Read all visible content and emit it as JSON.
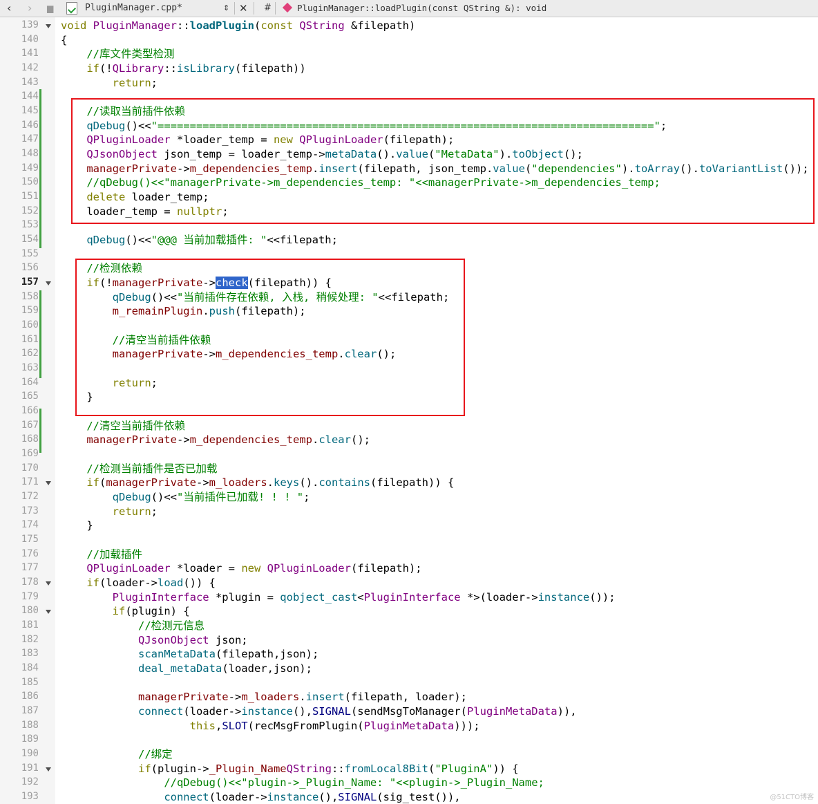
{
  "toolbar": {
    "file_name": "PluginManager.cpp*",
    "hash": "#",
    "symbol": "PluginManager::loadPlugin(const QString &): void"
  },
  "editor": {
    "line_numbers": [
      "139",
      "140",
      "141",
      "142",
      "143",
      "144",
      "145",
      "146",
      "147",
      "148",
      "149",
      "150",
      "151",
      "152",
      "153",
      "154",
      "155",
      "156",
      "157",
      "158",
      "159",
      "160",
      "161",
      "162",
      "163",
      "164",
      "165",
      "166",
      "167",
      "168",
      "169",
      "170",
      "171",
      "172",
      "173",
      "174",
      "175",
      "176",
      "177",
      "178",
      "179",
      "180",
      "181",
      "182",
      "183",
      "184",
      "185",
      "186",
      "187",
      "188",
      "189",
      "190",
      "191",
      "192",
      "193"
    ],
    "current_line": "157",
    "selected_word": "check",
    "lines": [
      [
        [
          "k",
          "void "
        ],
        [
          "t",
          "PluginManager"
        ],
        [
          "",
          "::"
        ],
        [
          "fb",
          "loadPlugin"
        ],
        [
          "",
          "("
        ],
        [
          "k",
          "const "
        ],
        [
          "t",
          "QString "
        ],
        [
          "",
          "&filepath)"
        ]
      ],
      [
        [
          "",
          "{"
        ]
      ],
      [
        [
          "",
          "    "
        ],
        [
          "c",
          "//库文件类型检测"
        ]
      ],
      [
        [
          "",
          "    "
        ],
        [
          "k",
          "if"
        ],
        [
          "",
          "(!"
        ],
        [
          "t",
          "QLibrary"
        ],
        [
          "",
          "::"
        ],
        [
          "f",
          "isLibrary"
        ],
        [
          "",
          "(filepath))"
        ]
      ],
      [
        [
          "",
          "        "
        ],
        [
          "k",
          "return"
        ],
        [
          "",
          ";"
        ]
      ],
      [],
      [
        [
          "",
          "    "
        ],
        [
          "c",
          "//读取当前插件依赖"
        ]
      ],
      [
        [
          "",
          "    "
        ],
        [
          "f",
          "qDebug"
        ],
        [
          "",
          "()<<"
        ],
        [
          "s",
          "\"=============================================================================\""
        ],
        [
          "",
          ";"
        ]
      ],
      [
        [
          "",
          "    "
        ],
        [
          "t",
          "QPluginLoader "
        ],
        [
          "",
          "*loader_temp = "
        ],
        [
          "k",
          "new "
        ],
        [
          "t",
          "QPluginLoader"
        ],
        [
          "",
          "(filepath);"
        ]
      ],
      [
        [
          "",
          "    "
        ],
        [
          "t",
          "QJsonObject "
        ],
        [
          "",
          "json_temp = loader_temp->"
        ],
        [
          "f",
          "metaData"
        ],
        [
          "",
          "()."
        ],
        [
          "f",
          "value"
        ],
        [
          "",
          "("
        ],
        [
          "s",
          "\"MetaData\""
        ],
        [
          "",
          ")."
        ],
        [
          "f",
          "toObject"
        ],
        [
          "",
          "();"
        ]
      ],
      [
        [
          "",
          "    "
        ],
        [
          "m",
          "managerPrivate"
        ],
        [
          "",
          "->"
        ],
        [
          "m",
          "m_dependencies_temp"
        ],
        [
          "",
          "."
        ],
        [
          "f",
          "insert"
        ],
        [
          "",
          "(filepath, json_temp."
        ],
        [
          "f",
          "value"
        ],
        [
          "",
          "("
        ],
        [
          "s",
          "\"dependencies\""
        ],
        [
          "",
          ")."
        ],
        [
          "f",
          "toArray"
        ],
        [
          "",
          "()."
        ],
        [
          "f",
          "toVariantList"
        ],
        [
          "",
          "());"
        ]
      ],
      [
        [
          "",
          "    "
        ],
        [
          "c",
          "//qDebug()<<\"managerPrivate->m_dependencies_temp: \"<<managerPrivate->m_dependencies_temp;"
        ]
      ],
      [
        [
          "",
          "    "
        ],
        [
          "k",
          "delete "
        ],
        [
          "",
          "loader_temp;"
        ]
      ],
      [
        [
          "",
          "    "
        ],
        [
          "",
          "loader_temp = "
        ],
        [
          "k",
          "nullptr"
        ],
        [
          "",
          ";"
        ]
      ],
      [],
      [
        [
          "",
          "    "
        ],
        [
          "f",
          "qDebug"
        ],
        [
          "",
          "()<<"
        ],
        [
          "s",
          "\"@@@ 当前加载插件: \""
        ],
        [
          "",
          "<<filepath;"
        ]
      ],
      [],
      [
        [
          "",
          "    "
        ],
        [
          "c",
          "//检测依赖"
        ]
      ],
      [
        [
          "",
          "    "
        ],
        [
          "k",
          "if"
        ],
        [
          "",
          "(!"
        ],
        [
          "m",
          "managerPrivate"
        ],
        [
          "",
          "->"
        ],
        [
          "hl",
          "check"
        ],
        [
          "",
          "(filepath)) {"
        ]
      ],
      [
        [
          "",
          "        "
        ],
        [
          "f",
          "qDebug"
        ],
        [
          "",
          "()<<"
        ],
        [
          "s",
          "\"当前插件存在依赖, 入栈, 稍候处理: \""
        ],
        [
          "",
          "<<filepath;"
        ]
      ],
      [
        [
          "",
          "        "
        ],
        [
          "m",
          "m_remainPlugin"
        ],
        [
          "",
          "."
        ],
        [
          "f",
          "push"
        ],
        [
          "",
          "(filepath);"
        ]
      ],
      [],
      [
        [
          "",
          "        "
        ],
        [
          "c",
          "//清空当前插件依赖"
        ]
      ],
      [
        [
          "",
          "        "
        ],
        [
          "m",
          "managerPrivate"
        ],
        [
          "",
          "->"
        ],
        [
          "m",
          "m_dependencies_temp"
        ],
        [
          "",
          "."
        ],
        [
          "f",
          "clear"
        ],
        [
          "",
          "();"
        ]
      ],
      [],
      [
        [
          "",
          "        "
        ],
        [
          "k",
          "return"
        ],
        [
          "",
          ";"
        ]
      ],
      [
        [
          "",
          "    }"
        ]
      ],
      [],
      [
        [
          "",
          "    "
        ],
        [
          "c",
          "//清空当前插件依赖"
        ]
      ],
      [
        [
          "",
          "    "
        ],
        [
          "m",
          "managerPrivate"
        ],
        [
          "",
          "->"
        ],
        [
          "m",
          "m_dependencies_temp"
        ],
        [
          "",
          "."
        ],
        [
          "f",
          "clear"
        ],
        [
          "",
          "();"
        ]
      ],
      [],
      [
        [
          "",
          "    "
        ],
        [
          "c",
          "//检测当前插件是否已加载"
        ]
      ],
      [
        [
          "",
          "    "
        ],
        [
          "k",
          "if"
        ],
        [
          "",
          "("
        ],
        [
          "m",
          "managerPrivate"
        ],
        [
          "",
          "->"
        ],
        [
          "m",
          "m_loaders"
        ],
        [
          "",
          "."
        ],
        [
          "f",
          "keys"
        ],
        [
          "",
          "()."
        ],
        [
          "f",
          "contains"
        ],
        [
          "",
          "(filepath)) {"
        ]
      ],
      [
        [
          "",
          "        "
        ],
        [
          "f",
          "qDebug"
        ],
        [
          "",
          "()<<"
        ],
        [
          "s",
          "\"当前插件已加载! ! ! \""
        ],
        [
          "",
          ";"
        ]
      ],
      [
        [
          "",
          "        "
        ],
        [
          "k",
          "return"
        ],
        [
          "",
          ";"
        ]
      ],
      [
        [
          "",
          "    }"
        ]
      ],
      [],
      [
        [
          "",
          "    "
        ],
        [
          "c",
          "//加载插件"
        ]
      ],
      [
        [
          "",
          "    "
        ],
        [
          "t",
          "QPluginLoader "
        ],
        [
          "",
          "*loader = "
        ],
        [
          "k",
          "new "
        ],
        [
          "t",
          "QPluginLoader"
        ],
        [
          "",
          "(filepath);"
        ]
      ],
      [
        [
          "",
          "    "
        ],
        [
          "k",
          "if"
        ],
        [
          "",
          "(loader->"
        ],
        [
          "f",
          "load"
        ],
        [
          "",
          "()) {"
        ]
      ],
      [
        [
          "",
          "        "
        ],
        [
          "t",
          "PluginInterface "
        ],
        [
          "",
          "*plugin = "
        ],
        [
          "f",
          "qobject_cast"
        ],
        [
          "",
          "<"
        ],
        [
          "t",
          "PluginInterface "
        ],
        [
          "",
          "*>(loader->"
        ],
        [
          "f",
          "instance"
        ],
        [
          "",
          "());"
        ]
      ],
      [
        [
          "",
          "        "
        ],
        [
          "k",
          "if"
        ],
        [
          "",
          "(plugin) {"
        ]
      ],
      [
        [
          "",
          "            "
        ],
        [
          "c",
          "//检测元信息"
        ]
      ],
      [
        [
          "",
          "            "
        ],
        [
          "t",
          "QJsonObject "
        ],
        [
          "",
          "json;"
        ]
      ],
      [
        [
          "",
          "            "
        ],
        [
          "f",
          "scanMetaData"
        ],
        [
          "",
          "(filepath,json);"
        ]
      ],
      [
        [
          "",
          "            "
        ],
        [
          "f",
          "deal_metaData"
        ],
        [
          "",
          "(loader,json);"
        ]
      ],
      [],
      [
        [
          "",
          "            "
        ],
        [
          "m",
          "managerPrivate"
        ],
        [
          "",
          "->"
        ],
        [
          "m",
          "m_loaders"
        ],
        [
          "",
          "."
        ],
        [
          "f",
          "insert"
        ],
        [
          "",
          "(filepath, loader);"
        ]
      ],
      [
        [
          "",
          "            "
        ],
        [
          "f",
          "connect"
        ],
        [
          "",
          "(loader->"
        ],
        [
          "f",
          "instance"
        ],
        [
          "",
          "(),"
        ],
        [
          "n",
          "SIGNAL"
        ],
        [
          "",
          "(sendMsgToManager("
        ],
        [
          "t",
          "PluginMetaData"
        ],
        [
          "",
          ")),"
        ]
      ],
      [
        [
          "",
          "                    "
        ],
        [
          "k",
          "this"
        ],
        [
          "",
          ","
        ],
        [
          "n",
          "SLOT"
        ],
        [
          "",
          "(recMsgFromPlugin("
        ],
        [
          "t",
          "PluginMetaData"
        ],
        [
          "",
          ")));"
        ]
      ],
      [],
      [
        [
          "",
          "            "
        ],
        [
          "c",
          "//绑定"
        ]
      ],
      [
        [
          "",
          "            "
        ],
        [
          "k",
          "if"
        ],
        [
          "",
          "(plugin->"
        ],
        [
          "m",
          "_Plugin_Name"
        ],
        [
          "",
          "",
          " == "
        ],
        [
          "t",
          "QString"
        ],
        [
          "",
          "::"
        ],
        [
          "f",
          "fromLocal8Bit"
        ],
        [
          "",
          "("
        ],
        [
          "s",
          "\"PluginA\""
        ],
        [
          "",
          ")) {"
        ]
      ],
      [
        [
          "",
          "                "
        ],
        [
          "c",
          "//qDebug()<<\"plugin->_Plugin_Name: \"<<plugin->_Plugin_Name;"
        ]
      ],
      [
        [
          "",
          "                "
        ],
        [
          "f",
          "connect"
        ],
        [
          "",
          "(loader->"
        ],
        [
          "f",
          "instance"
        ],
        [
          "",
          "(),"
        ],
        [
          "n",
          "SIGNAL"
        ],
        [
          "",
          "(sig_test()),"
        ]
      ]
    ]
  },
  "watermark": "@51CTO博客",
  "colors": {
    "annotation_box": "#e8151b",
    "change_bar": "#40a040",
    "selection": "#2f65ca"
  }
}
